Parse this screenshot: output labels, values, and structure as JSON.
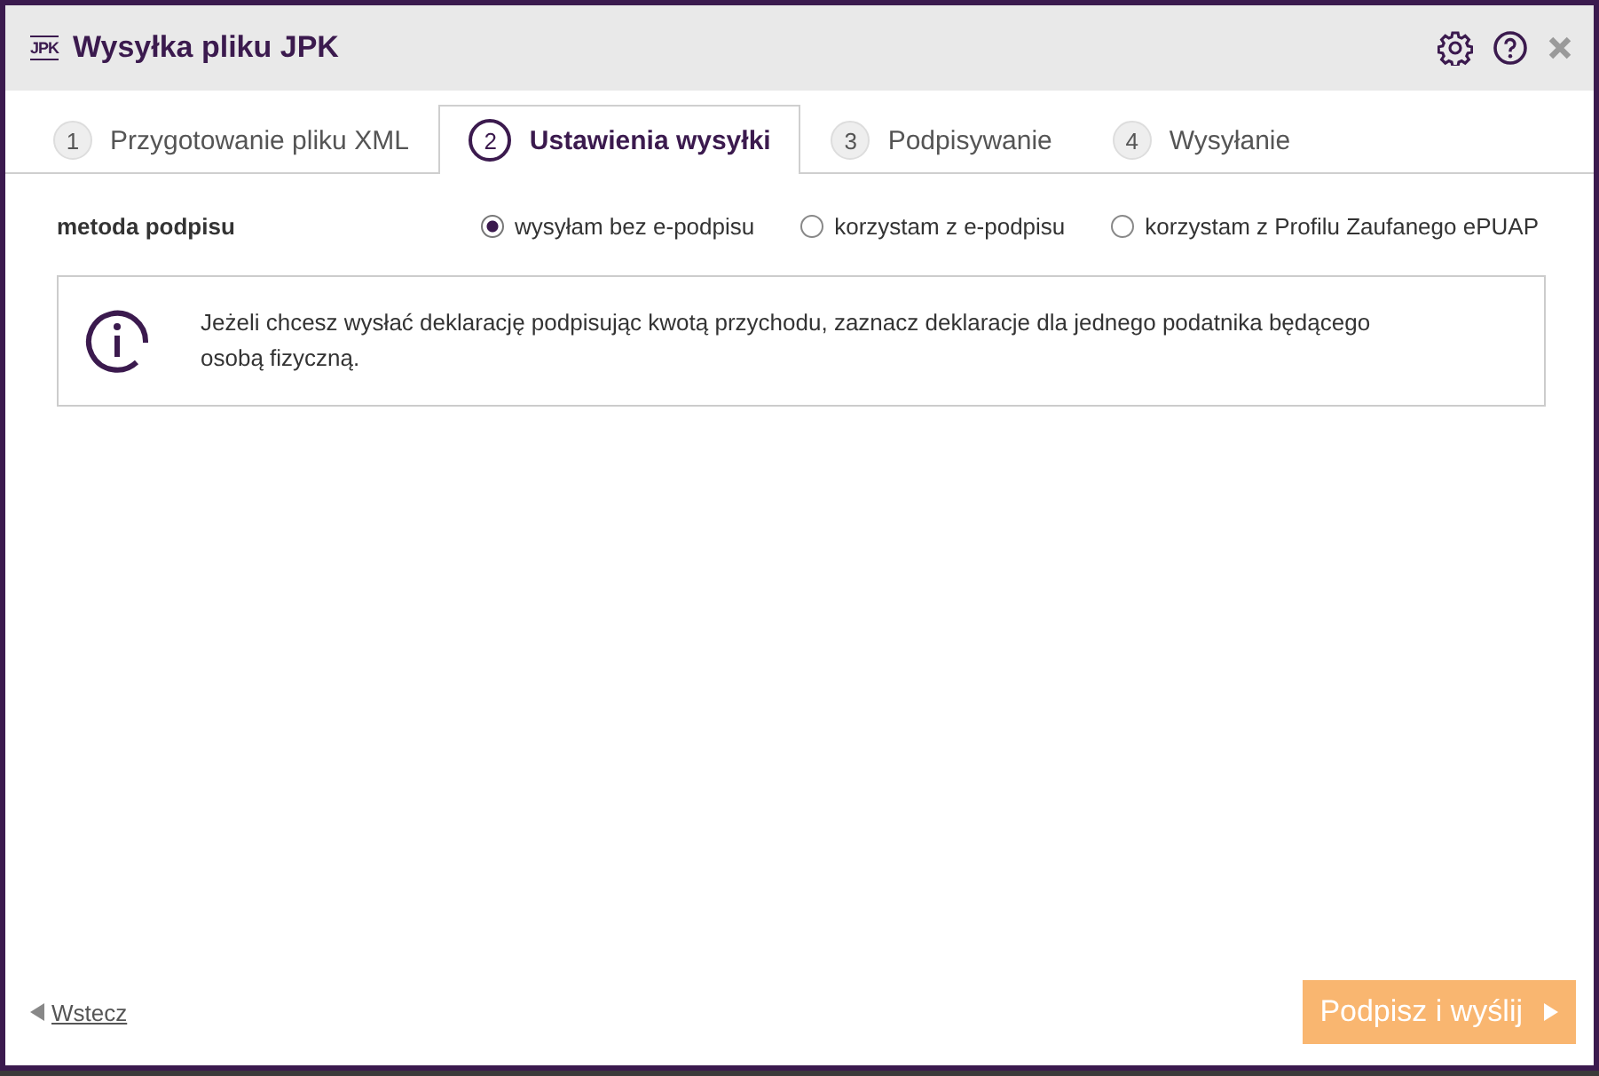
{
  "window": {
    "logo": "JPK",
    "title": "Wysyłka pliku JPK"
  },
  "tabs": [
    {
      "number": "1",
      "label": "Przygotowanie pliku XML",
      "selected": false
    },
    {
      "number": "2",
      "label": "Ustawienia wysyłki",
      "selected": true
    },
    {
      "number": "3",
      "label": "Podpisywanie",
      "selected": false
    },
    {
      "number": "4",
      "label": "Wysyłanie",
      "selected": false
    }
  ],
  "signature_method": {
    "label": "metoda podpisu",
    "options": [
      {
        "label": "wysyłam bez e-podpisu",
        "selected": true
      },
      {
        "label": "korzystam z e-podpisu",
        "selected": false
      },
      {
        "label": "korzystam z Profilu Zaufanego ePUAP",
        "selected": false
      }
    ]
  },
  "info": "Jeżeli chcesz wysłać deklarację podpisując kwotą przychodu, zaznacz deklaracje dla jednego podatnika będącego osobą fizyczną.",
  "footer": {
    "back": "Wstecz",
    "submit": {
      "label": "Podpisz i wyślij",
      "disabled": true
    }
  }
}
